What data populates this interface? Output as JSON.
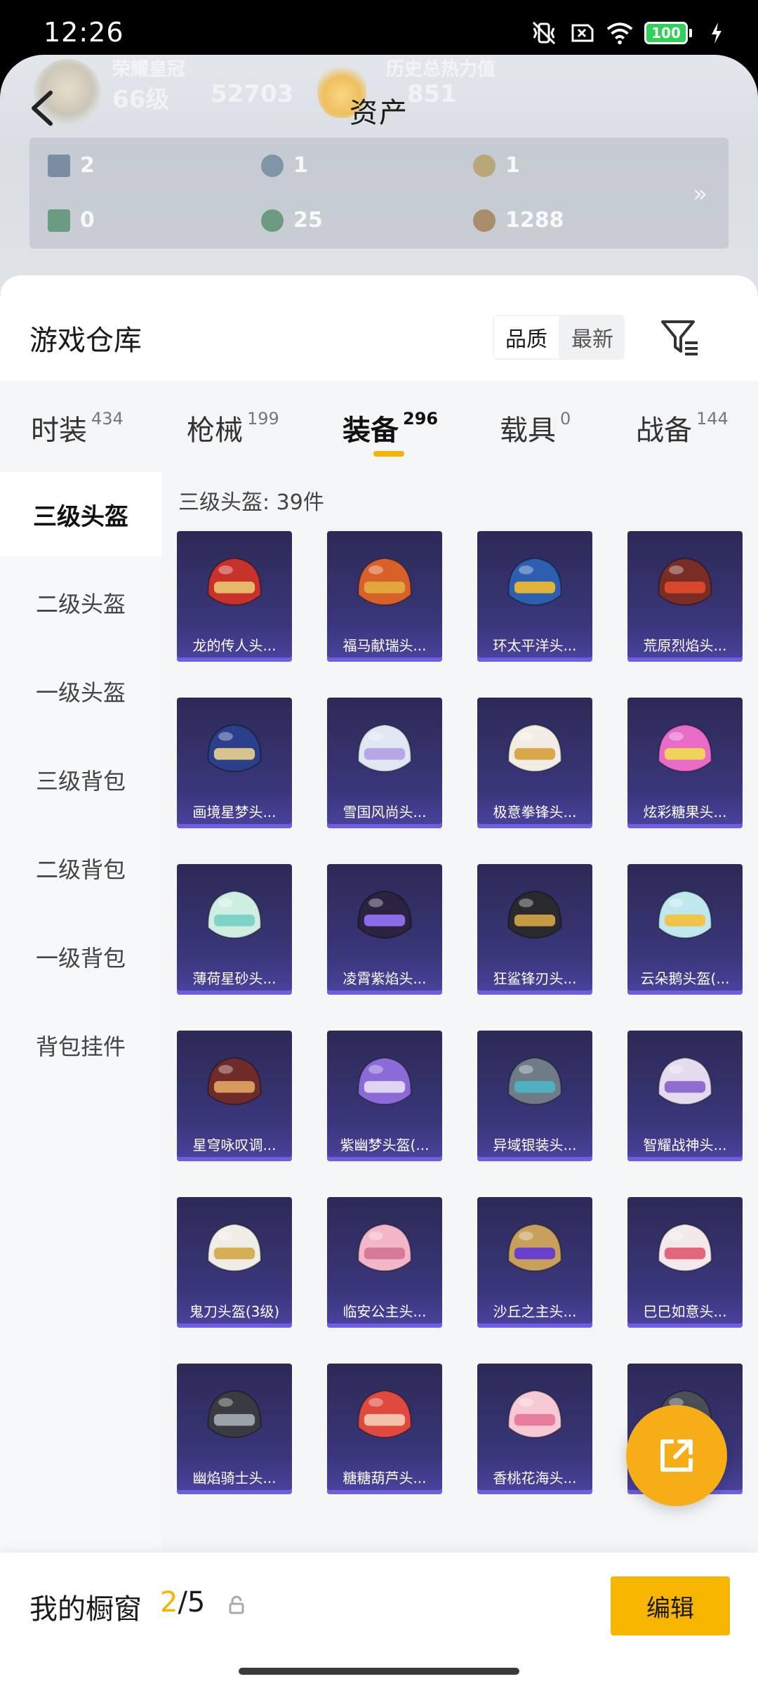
{
  "status_bar": {
    "time": "12:26",
    "battery": "100"
  },
  "header": {
    "title": "资产",
    "ghost_rank_text": "荣耀皇冠",
    "ghost_level": "66级",
    "ghost_points": "52703",
    "ghost_heat_label": "历史总热力值",
    "ghost_heat_value": "851",
    "assets": [
      {
        "value": "2",
        "color": "#7b8da3"
      },
      {
        "value": "1",
        "color": "#7f95a8"
      },
      {
        "value": "1",
        "color": "#b9a679"
      },
      {
        "value": "0",
        "color": "#6a9c84"
      },
      {
        "value": "25",
        "color": "#6d9a80"
      },
      {
        "value": "1288",
        "color": "#a88d6a"
      }
    ],
    "more_icon": "double-chevron-right-icon"
  },
  "warehouse": {
    "title": "游戏仓库",
    "sort_options": [
      "品质",
      "最新"
    ],
    "sort_active": "品质"
  },
  "categories": [
    {
      "name": "时装",
      "count": "434"
    },
    {
      "name": "枪械",
      "count": "199"
    },
    {
      "name": "装备",
      "count": "296"
    },
    {
      "name": "载具",
      "count": "0"
    },
    {
      "name": "战备",
      "count": "144"
    }
  ],
  "active_category": "装备",
  "sidebar": [
    "三级头盔",
    "二级头盔",
    "一级头盔",
    "三级背包",
    "二级背包",
    "一级背包",
    "背包挂件"
  ],
  "active_sidebar": "三级头盔",
  "grid_heading": "三级头盔: 39件",
  "items": [
    {
      "name": "龙的传人头...",
      "color": "#c8322b",
      "accent": "#e6b86a"
    },
    {
      "name": "福马献瑞头...",
      "color": "#d8612a",
      "accent": "#e1a63c"
    },
    {
      "name": "环太平洋头...",
      "color": "#2d5fb0",
      "accent": "#e0b43a"
    },
    {
      "name": "荒原烈焰头...",
      "color": "#7a2d24",
      "accent": "#d9462a"
    },
    {
      "name": "画境星梦头...",
      "color": "#2c3f8a",
      "accent": "#d7c48a"
    },
    {
      "name": "雪国风尚头...",
      "color": "#dfe7f1",
      "accent": "#b9a6e6"
    },
    {
      "name": "极意拳锋头...",
      "color": "#f1ede4",
      "accent": "#d8a84a"
    },
    {
      "name": "炫彩糖果头...",
      "color": "#e86bc7",
      "accent": "#f2d35a"
    },
    {
      "name": "薄荷星砂头...",
      "color": "#cfeee2",
      "accent": "#7fd2c6"
    },
    {
      "name": "凌霄紫焰头...",
      "color": "#2b2340",
      "accent": "#8c6be8"
    },
    {
      "name": "狂鲨锋刃头...",
      "color": "#2a2a2e",
      "accent": "#c49a45"
    },
    {
      "name": "云朵鹅头盔(...",
      "color": "#bfe8ee",
      "accent": "#f2c34a"
    },
    {
      "name": "星穹咏叹调...",
      "color": "#6e2b2a",
      "accent": "#d79a5a"
    },
    {
      "name": "紫幽梦头盔(...",
      "color": "#8a6bd8",
      "accent": "#e0d4f4"
    },
    {
      "name": "异域银装头...",
      "color": "#6f7c87",
      "accent": "#4fb0c0"
    },
    {
      "name": "智耀战神头...",
      "color": "#e4dbee",
      "accent": "#8f6cd0"
    },
    {
      "name": "鬼刀头盔(3级)",
      "color": "#f0ede6",
      "accent": "#d3ae55"
    },
    {
      "name": "临安公主头...",
      "color": "#f2b6c8",
      "accent": "#d67a9a"
    },
    {
      "name": "沙丘之主头...",
      "color": "#c8a05a",
      "accent": "#6a3fd0"
    },
    {
      "name": "巳巳如意头...",
      "color": "#f4e9ea",
      "accent": "#e3677c"
    },
    {
      "name": "幽焰骑士头...",
      "color": "#3a3b40",
      "accent": "#9aa3a8"
    },
    {
      "name": "糖糖葫芦头...",
      "color": "#e0493e",
      "accent": "#f3c0a8"
    },
    {
      "name": "香桃花海头...",
      "color": "#f7c9d4",
      "accent": "#e87e9c"
    },
    {
      "name": "",
      "color": "#4a4f58",
      "accent": "#c0c6cc"
    }
  ],
  "showcase": {
    "label": "我的橱窗",
    "current": "2",
    "total": "/5"
  },
  "edit_label": "编辑"
}
